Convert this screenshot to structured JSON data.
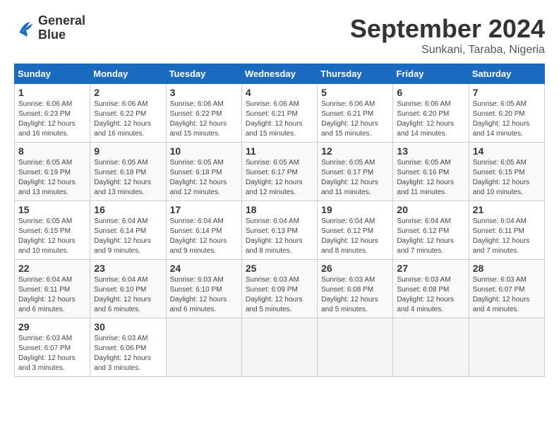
{
  "logo": {
    "line1": "General",
    "line2": "Blue"
  },
  "title": "September 2024",
  "subtitle": "Sunkani, Taraba, Nigeria",
  "weekdays": [
    "Sunday",
    "Monday",
    "Tuesday",
    "Wednesday",
    "Thursday",
    "Friday",
    "Saturday"
  ],
  "weeks": [
    [
      {
        "day": 1,
        "sunrise": "6:06 AM",
        "sunset": "6:23 PM",
        "daylight": "12 hours and 16 minutes."
      },
      {
        "day": 2,
        "sunrise": "6:06 AM",
        "sunset": "6:22 PM",
        "daylight": "12 hours and 16 minutes."
      },
      {
        "day": 3,
        "sunrise": "6:06 AM",
        "sunset": "6:22 PM",
        "daylight": "12 hours and 15 minutes."
      },
      {
        "day": 4,
        "sunrise": "6:06 AM",
        "sunset": "6:21 PM",
        "daylight": "12 hours and 15 minutes."
      },
      {
        "day": 5,
        "sunrise": "6:06 AM",
        "sunset": "6:21 PM",
        "daylight": "12 hours and 15 minutes."
      },
      {
        "day": 6,
        "sunrise": "6:06 AM",
        "sunset": "6:20 PM",
        "daylight": "12 hours and 14 minutes."
      },
      {
        "day": 7,
        "sunrise": "6:05 AM",
        "sunset": "6:20 PM",
        "daylight": "12 hours and 14 minutes."
      }
    ],
    [
      {
        "day": 8,
        "sunrise": "6:05 AM",
        "sunset": "6:19 PM",
        "daylight": "12 hours and 13 minutes."
      },
      {
        "day": 9,
        "sunrise": "6:05 AM",
        "sunset": "6:18 PM",
        "daylight": "12 hours and 13 minutes."
      },
      {
        "day": 10,
        "sunrise": "6:05 AM",
        "sunset": "6:18 PM",
        "daylight": "12 hours and 12 minutes."
      },
      {
        "day": 11,
        "sunrise": "6:05 AM",
        "sunset": "6:17 PM",
        "daylight": "12 hours and 12 minutes."
      },
      {
        "day": 12,
        "sunrise": "6:05 AM",
        "sunset": "6:17 PM",
        "daylight": "12 hours and 11 minutes."
      },
      {
        "day": 13,
        "sunrise": "6:05 AM",
        "sunset": "6:16 PM",
        "daylight": "12 hours and 11 minutes."
      },
      {
        "day": 14,
        "sunrise": "6:05 AM",
        "sunset": "6:15 PM",
        "daylight": "12 hours and 10 minutes."
      }
    ],
    [
      {
        "day": 15,
        "sunrise": "6:05 AM",
        "sunset": "6:15 PM",
        "daylight": "12 hours and 10 minutes."
      },
      {
        "day": 16,
        "sunrise": "6:04 AM",
        "sunset": "6:14 PM",
        "daylight": "12 hours and 9 minutes."
      },
      {
        "day": 17,
        "sunrise": "6:04 AM",
        "sunset": "6:14 PM",
        "daylight": "12 hours and 9 minutes."
      },
      {
        "day": 18,
        "sunrise": "6:04 AM",
        "sunset": "6:13 PM",
        "daylight": "12 hours and 8 minutes."
      },
      {
        "day": 19,
        "sunrise": "6:04 AM",
        "sunset": "6:12 PM",
        "daylight": "12 hours and 8 minutes."
      },
      {
        "day": 20,
        "sunrise": "6:04 AM",
        "sunset": "6:12 PM",
        "daylight": "12 hours and 7 minutes."
      },
      {
        "day": 21,
        "sunrise": "6:04 AM",
        "sunset": "6:11 PM",
        "daylight": "12 hours and 7 minutes."
      }
    ],
    [
      {
        "day": 22,
        "sunrise": "6:04 AM",
        "sunset": "6:11 PM",
        "daylight": "12 hours and 6 minutes."
      },
      {
        "day": 23,
        "sunrise": "6:04 AM",
        "sunset": "6:10 PM",
        "daylight": "12 hours and 6 minutes."
      },
      {
        "day": 24,
        "sunrise": "6:03 AM",
        "sunset": "6:10 PM",
        "daylight": "12 hours and 6 minutes."
      },
      {
        "day": 25,
        "sunrise": "6:03 AM",
        "sunset": "6:09 PM",
        "daylight": "12 hours and 5 minutes."
      },
      {
        "day": 26,
        "sunrise": "6:03 AM",
        "sunset": "6:08 PM",
        "daylight": "12 hours and 5 minutes."
      },
      {
        "day": 27,
        "sunrise": "6:03 AM",
        "sunset": "6:08 PM",
        "daylight": "12 hours and 4 minutes."
      },
      {
        "day": 28,
        "sunrise": "6:03 AM",
        "sunset": "6:07 PM",
        "daylight": "12 hours and 4 minutes."
      }
    ],
    [
      {
        "day": 29,
        "sunrise": "6:03 AM",
        "sunset": "6:07 PM",
        "daylight": "12 hours and 3 minutes."
      },
      {
        "day": 30,
        "sunrise": "6:03 AM",
        "sunset": "6:06 PM",
        "daylight": "12 hours and 3 minutes."
      },
      null,
      null,
      null,
      null,
      null
    ]
  ]
}
